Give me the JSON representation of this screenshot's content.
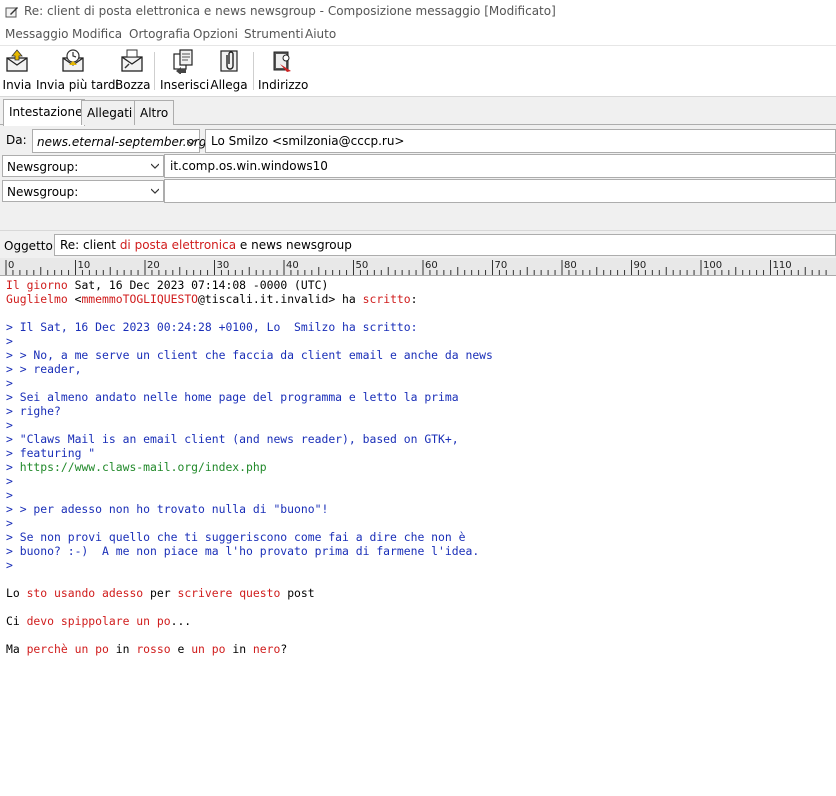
{
  "window": {
    "title": "Re: client di posta elettronica e news newsgroup - Composizione messaggio [Modificato]"
  },
  "menu": [
    "Messaggio",
    "Modifica",
    "Ortografia",
    "Opzioni",
    "Strumenti",
    "Aiuto"
  ],
  "toolbar": {
    "send": "Invia",
    "send_later": "Invia più tardi",
    "draft": "Bozza",
    "insert": "Inserisci",
    "attach": "Allega",
    "address": "Indirizzo"
  },
  "tabs": [
    "Intestazione",
    "Allegati",
    "Altro"
  ],
  "header": {
    "from_label": "Da:",
    "account": "news.eternal-september.org",
    "from_value": "Lo Smilzo <smilzonia@cccp.ru>",
    "row1_type": "Newsgroup:",
    "row1_value": "it.comp.os.win.windows10",
    "row2_type": "Newsgroup:",
    "row2_value": "",
    "subject_label": "Oggetto:",
    "subject": {
      "p1": "Re: client ",
      "p2": "di posta elettronica",
      "p3": " e news newsgroup"
    }
  },
  "ruler": {
    "labels": [
      "0",
      "10",
      "20",
      "30",
      "40",
      "50",
      "60",
      "70",
      "80",
      "90",
      "100",
      "110"
    ]
  },
  "body": {
    "attrib1_a": "Il giorno",
    "attrib1_b": " Sat, 16 Dec 2023 07:14:08 -0000 (UTC)",
    "attrib2_a": "Guglielmo",
    "attrib2_b": " <",
    "attrib2_c": "mmemmoTOGLIQUESTO",
    "attrib2_d": "@tiscali.it.invalid> ha ",
    "attrib2_e": "scritto",
    "attrib2_f": ":",
    "quoted": [
      "",
      "> Il Sat, 16 Dec 2023 00:24:28 +0100, Lo  Smilzo ha scritto:",
      ">",
      "> > No, a me serve un client che faccia da client email e anche da news",
      "> > reader,",
      ">",
      "> Sei almeno andato nelle home page del programma e letto la prima",
      "> righe?",
      ">",
      "> \"Claws Mail is an email client (and news reader), based on GTK+,",
      "> featuring \""
    ],
    "link_prefix": "> ",
    "link": "https://www.claws-mail.org/index.php",
    "quoted2": [
      ">",
      ">",
      "> > per adesso non ho trovato nulla di \"buono\"!",
      ">",
      "> Se non provi quello che ti suggeriscono come fai a dire che non è",
      "> buono? :-)  A me non piace ma l'ho provato prima di farmene l'idea.",
      ">"
    ],
    "line_a": {
      "w1": "Lo ",
      "w2": "sto usando adesso",
      "w3": " per ",
      "w4": "scrivere questo",
      "w5": " post"
    },
    "line_b": {
      "w1": "Ci ",
      "w2": "devo spippolare un po",
      "w3": "..."
    },
    "line_c": {
      "w1": "Ma ",
      "w2": "perchè un po",
      "w3": " in ",
      "w4": "rosso",
      "w5": " e ",
      "w6": "un po",
      "w7": " in ",
      "w8": "nero",
      "w9": "?"
    }
  }
}
